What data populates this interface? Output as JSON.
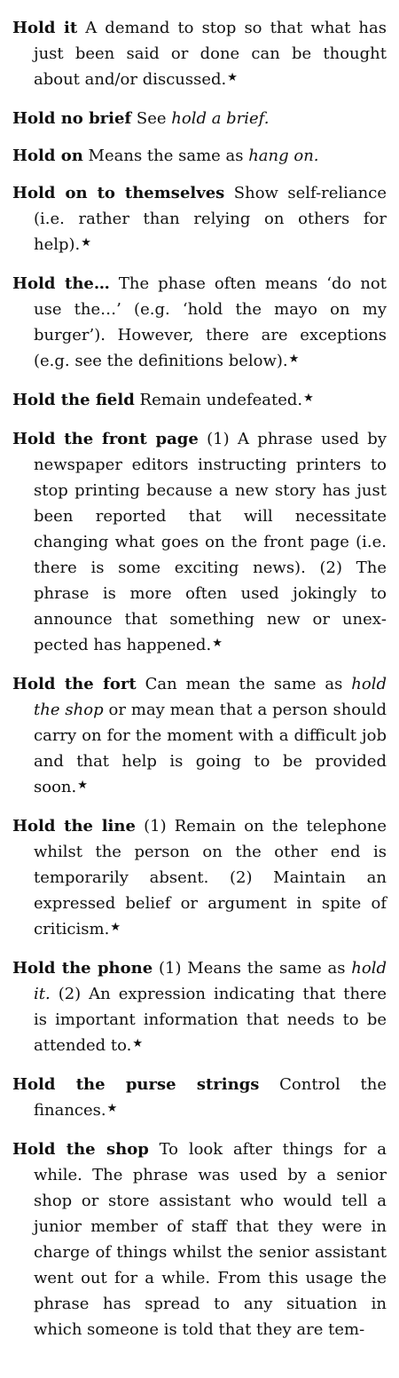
{
  "entries": [
    {
      "term": "Hold it",
      "parts": [
        {
          "t": "A demand to stop so that what has just been said or done can be thought about and/or discussed."
        }
      ],
      "star": true
    },
    {
      "term": "Hold no brief",
      "parts": [
        {
          "t": "See "
        },
        {
          "t": "hold a brief.",
          "i": true
        }
      ],
      "star": false
    },
    {
      "term": "Hold on",
      "parts": [
        {
          "t": "Means the same as "
        },
        {
          "t": "hang on.",
          "i": true
        }
      ],
      "star": false
    },
    {
      "term": "Hold on to themselves",
      "parts": [
        {
          "t": "Show self-reliance (i.e. rather than relying on others for help)."
        }
      ],
      "star": true
    },
    {
      "term": "Hold the…",
      "parts": [
        {
          "t": "The phase often means ‘do not use the…’ (e.g. ‘hold the mayo on my burger’). However, there are exceptions (e.g. see the definitions below)."
        }
      ],
      "star": true
    },
    {
      "term": "Hold the field",
      "parts": [
        {
          "t": "Remain undefeated."
        }
      ],
      "star": true
    },
    {
      "term": "Hold the front page",
      "parts": [
        {
          "t": "(1) A phrase used by newspaper editors instructing printers to stop printing because a new story has just been reported that will necessitate changing what goes on the front page (i.e. there is some exciting news). (2) The phrase is more often used jokingly to announce that something new or unex­pected has happened."
        }
      ],
      "star": true
    },
    {
      "term": "Hold the fort",
      "parts": [
        {
          "t": "Can mean the same as "
        },
        {
          "t": "hold the shop",
          "i": true
        },
        {
          "t": " or may mean that a person should carry on for the moment with a difficult job and that help is going to be provided soon."
        }
      ],
      "star": true
    },
    {
      "term": "Hold the line",
      "parts": [
        {
          "t": "(1) Remain on the telephone whilst the person on the other end is temporarily absent. (2) Maintain an expressed belief or argument in spite of criticism."
        }
      ],
      "star": true
    },
    {
      "term": "Hold the phone",
      "parts": [
        {
          "t": "(1) Means the same as "
        },
        {
          "t": "hold it.",
          "i": true
        },
        {
          "t": " (2) An expression indicating that there is important information that needs to be attended to."
        }
      ],
      "star": true
    },
    {
      "term": "Hold the purse strings",
      "parts": [
        {
          "t": "Control the finances."
        }
      ],
      "star": true
    },
    {
      "term": "Hold the shop",
      "parts": [
        {
          "t": "To look after things for a while. The phrase was used by a senior shop or store assistant who would tell a junior member of staff that they were in charge of things whilst the senior assis­tant went out for a while. From this usage the phrase has spread to any situation in which someone is told that they are tem-"
        }
      ],
      "star": false
    }
  ],
  "star_symbol": "★"
}
